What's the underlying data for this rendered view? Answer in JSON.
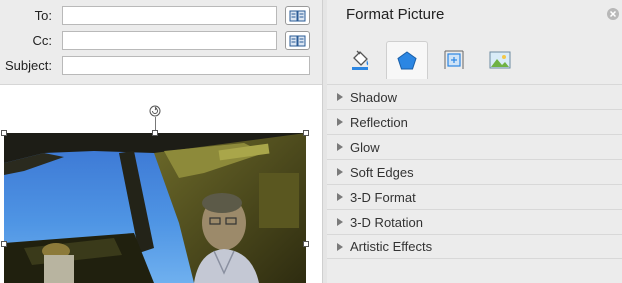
{
  "compose": {
    "to_label": "To:",
    "cc_label": "Cc:",
    "subject_label": "Subject:",
    "to_value": "",
    "cc_value": "",
    "subject_value": ""
  },
  "pane": {
    "title": "Format Picture",
    "tabs": [
      {
        "icon": "paint-bucket-icon"
      },
      {
        "icon": "shape-effects-icon"
      },
      {
        "icon": "size-properties-icon"
      },
      {
        "icon": "picture-icon"
      }
    ],
    "sections": [
      {
        "label": "Shadow"
      },
      {
        "label": "Reflection"
      },
      {
        "label": "Glow"
      },
      {
        "label": "Soft Edges"
      },
      {
        "label": "3-D Format"
      },
      {
        "label": "3-D Rotation"
      },
      {
        "label": "Artistic Effects"
      }
    ]
  },
  "colors": {
    "accent": "#2b86e3"
  }
}
